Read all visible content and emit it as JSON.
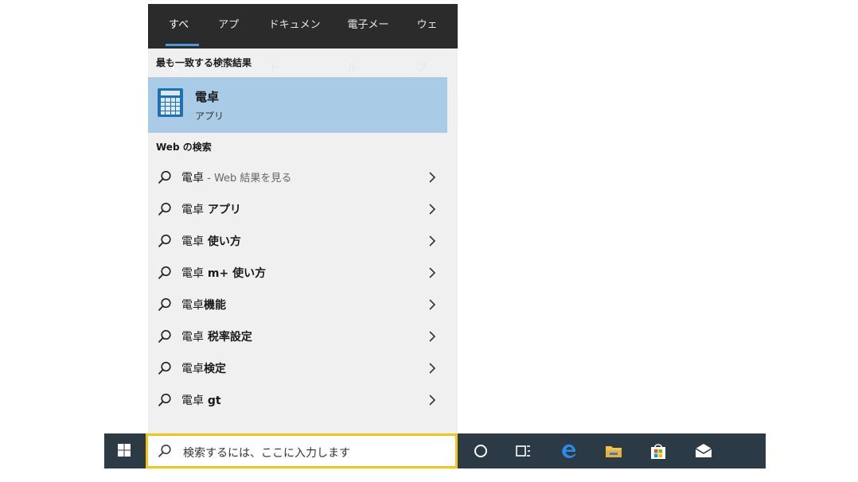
{
  "tabs": [
    {
      "label": "すべて"
    },
    {
      "label": "アプリ"
    },
    {
      "label": "ドキュメント"
    },
    {
      "label": "電子メール"
    },
    {
      "label": "ウェブ"
    }
  ],
  "best_match": {
    "section_title": "最も一致する検索結果",
    "title": "電卓",
    "subtitle": "アプリ",
    "icon": "calculator-icon"
  },
  "web_search": {
    "section_title": "Web の検索",
    "items": [
      {
        "query": "電卓",
        "rest": "",
        "hint": " - Web 結果を見る"
      },
      {
        "query": "電卓",
        "rest": " アプリ",
        "hint": ""
      },
      {
        "query": "電卓",
        "rest": " 使い方",
        "hint": ""
      },
      {
        "query": "電卓",
        "rest": " m+ 使い方",
        "hint": ""
      },
      {
        "query": "電卓",
        "rest": "機能",
        "hint": ""
      },
      {
        "query": "電卓",
        "rest": " 税率設定",
        "hint": ""
      },
      {
        "query": "電卓",
        "rest": "検定",
        "hint": ""
      },
      {
        "query": "電卓",
        "rest": " gt",
        "hint": ""
      }
    ]
  },
  "taskbar": {
    "search_placeholder": "検索するには、ここに入力します",
    "icons": [
      "windows-start-icon",
      "cortana-icon",
      "task-view-icon",
      "edge-icon",
      "file-explorer-icon",
      "store-icon",
      "mail-icon"
    ]
  },
  "colors": {
    "tabs_bg": "#2b2b2b",
    "tab_underline": "#4a9ae0",
    "panel_bg": "#f0f0f0",
    "highlight": "#a9cbe6",
    "taskbar_bg": "#2c3a45",
    "searchbox_border": "#f3c41a"
  }
}
